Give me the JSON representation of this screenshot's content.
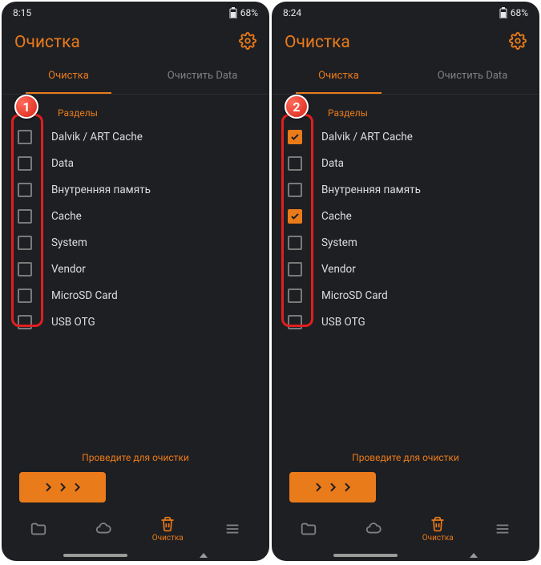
{
  "screens": [
    {
      "step": "1",
      "status": {
        "time": "8:15",
        "battery": "68%"
      },
      "header_title": "Очистка",
      "tabs": {
        "clean": "Очистка",
        "clear_data": "Очистить Data"
      },
      "section_label": "Разделы",
      "items": [
        {
          "label": "Dalvik / ART Cache",
          "checked": false
        },
        {
          "label": "Data",
          "checked": false
        },
        {
          "label": "Внутренняя память",
          "checked": false
        },
        {
          "label": "Cache",
          "checked": false
        },
        {
          "label": "System",
          "checked": false
        },
        {
          "label": "Vendor",
          "checked": false
        },
        {
          "label": "MicroSD Card",
          "checked": false
        },
        {
          "label": "USB OTG",
          "checked": false
        }
      ],
      "swipe_prompt": "Проведите для очистки",
      "nav": {
        "clean": "Очистка"
      }
    },
    {
      "step": "2",
      "status": {
        "time": "8:24",
        "battery": "68%"
      },
      "header_title": "Очистка",
      "tabs": {
        "clean": "Очистка",
        "clear_data": "Очистить Data"
      },
      "section_label": "Разделы",
      "items": [
        {
          "label": "Dalvik / ART Cache",
          "checked": true
        },
        {
          "label": "Data",
          "checked": false
        },
        {
          "label": "Внутренняя память",
          "checked": false
        },
        {
          "label": "Cache",
          "checked": true
        },
        {
          "label": "System",
          "checked": false
        },
        {
          "label": "Vendor",
          "checked": false
        },
        {
          "label": "MicroSD Card",
          "checked": false
        },
        {
          "label": "USB OTG",
          "checked": false
        }
      ],
      "swipe_prompt": "Проведите для очистки",
      "nav": {
        "clean": "Очистка"
      }
    }
  ]
}
